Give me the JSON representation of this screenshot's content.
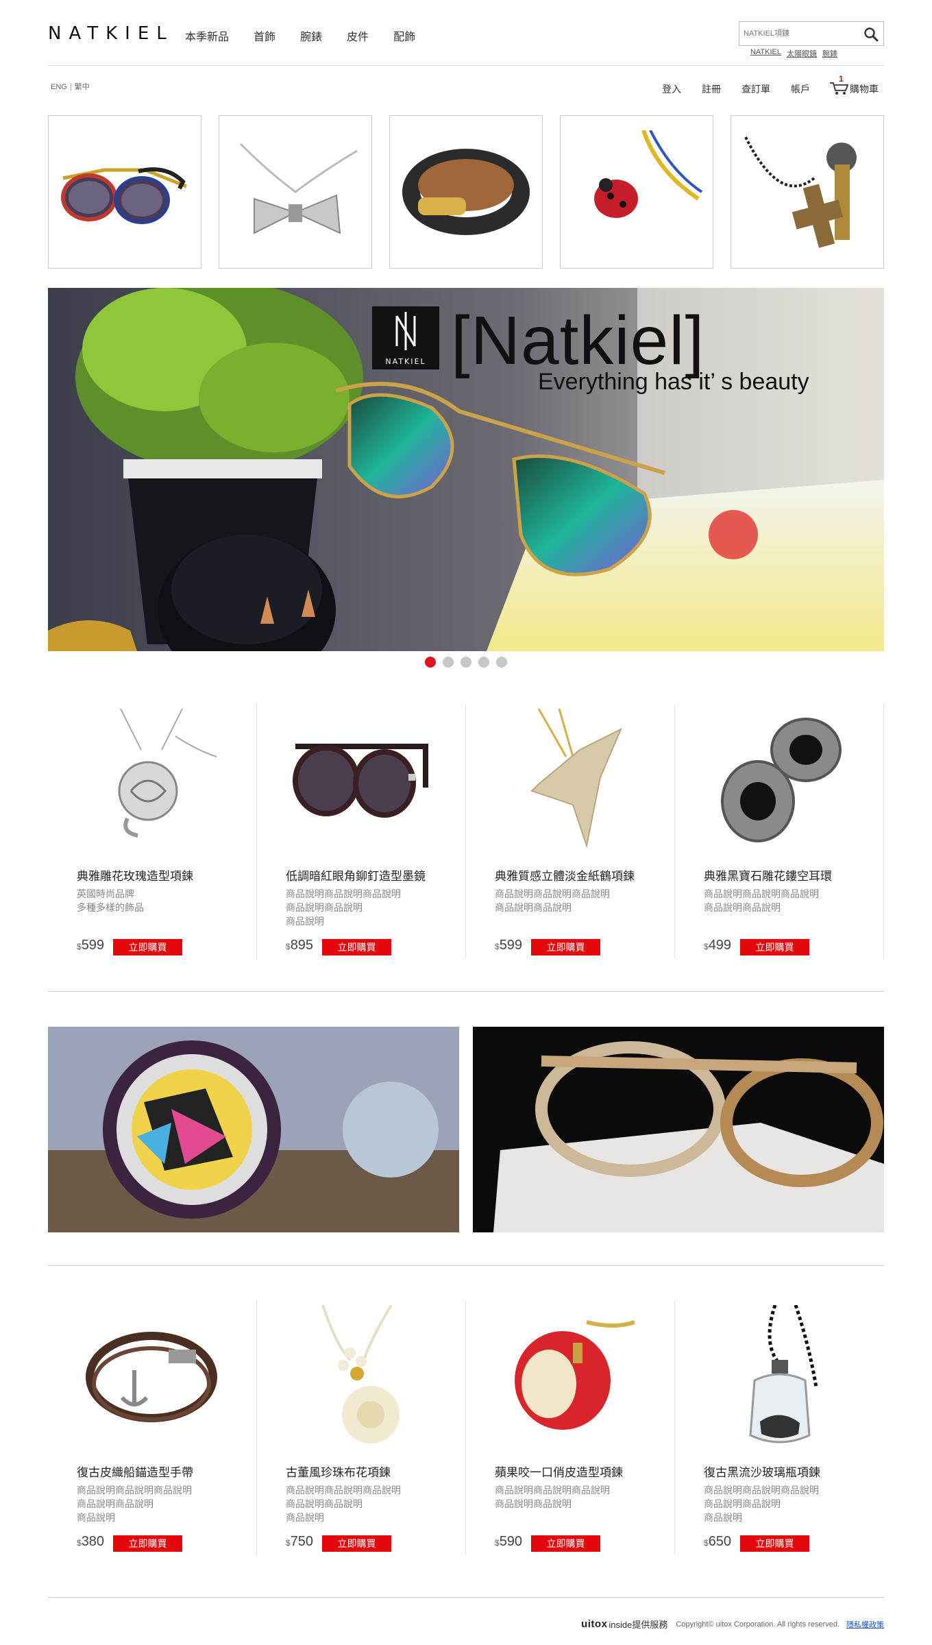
{
  "header": {
    "logo": "NATKIEL",
    "nav": [
      "本季新品",
      "首飾",
      "腕錶",
      "皮件",
      "配飾"
    ],
    "search_placeholder": "NATKIEL項鍊",
    "hot_words": [
      "NATKIEL",
      "太陽眼鏡",
      "腕錶"
    ]
  },
  "utility": {
    "lang_en": "ENG",
    "lang_zh": "繁中",
    "login": "登入",
    "register": "註冊",
    "orders": "查訂單",
    "account": "帳戶",
    "cart_label": "購物車",
    "cart_count": "1"
  },
  "thumbs": [
    "sunglasses-floral",
    "bow-necklace",
    "leather-bracelet",
    "ladybug-charm",
    "wood-cross-necklace"
  ],
  "hero": {
    "logo_text": "NATKIEL",
    "title": "[Natkiel]",
    "subtitle": "Everything has it’ s beauty",
    "slides": 5,
    "active_slide": 1
  },
  "products_1": [
    {
      "name": "典雅雕花玫瑰造型項鍊",
      "desc": [
        "英國時尚品牌",
        "多種多樣的飾品"
      ],
      "currency": "$",
      "price": "599",
      "buy": "立即購買"
    },
    {
      "name": "低調暗紅眼角鉚釘造型墨鏡",
      "desc": [
        "商品說明商品說明商品說明",
        "商品說明商品說明",
        "商品說明"
      ],
      "currency": "$",
      "price": "895",
      "buy": "立即購買"
    },
    {
      "name": "典雅質感立體淡金紙鶴項鍊",
      "desc": [
        "商品說明商品說明商品說明",
        "商品說明商品說明"
      ],
      "currency": "$",
      "price": "599",
      "buy": "立即購買"
    },
    {
      "name": "典雅黑寶石雕花鏤空耳環",
      "desc": [
        "商品說明商品說明商品說明",
        "商品說明商品說明"
      ],
      "currency": "$",
      "price": "499",
      "buy": "立即購買"
    }
  ],
  "promos": [
    "watch-banner",
    "glasses-banner"
  ],
  "products_2": [
    {
      "name": "復古皮織船錨造型手帶",
      "desc": [
        "商品說明商品說明商品說明",
        "商品說明商品說明",
        "商品說明"
      ],
      "currency": "$",
      "price": "380",
      "buy": "立即購買"
    },
    {
      "name": "古董風珍珠布花項鍊",
      "desc": [
        "商品說明商品說明商品說明",
        "商品說明商品說明",
        "商品說明"
      ],
      "currency": "$",
      "price": "750",
      "buy": "立即購買"
    },
    {
      "name": "蘋果咬一口俏皮造型項鍊",
      "desc": [
        "商品說明商品說明商品說明",
        "商品說明商品說明"
      ],
      "currency": "$",
      "price": "590",
      "buy": "立即購買"
    },
    {
      "name": "復古黑流沙玻璃瓶項鍊",
      "desc": [
        "商品說明商品說明商品說明",
        "商品說明商品說明",
        "商品說明"
      ],
      "currency": "$",
      "price": "650",
      "buy": "立即購買"
    }
  ],
  "footer": {
    "brand": "uitox",
    "brand2": "inside提供服務",
    "copyright": "Copyright© uitox Corporation. All rights reserved.",
    "privacy": "隱私權政策"
  },
  "colors": {
    "accent": "#e4080d",
    "dot_active": "#e0141e",
    "dot": "#c7c7c7",
    "link": "#1a56c4"
  }
}
